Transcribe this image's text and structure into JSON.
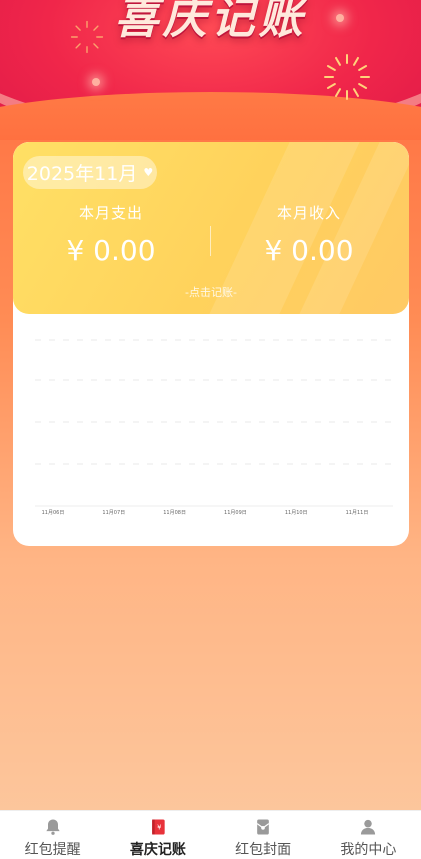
{
  "header": {
    "title": "喜庆记账"
  },
  "summary": {
    "month_selector": "2025年11月",
    "expense_label": "本月支出",
    "expense_value": "¥  0.00",
    "income_label": "本月收入",
    "income_value": "¥  0.00",
    "record_link": "-点击记账-"
  },
  "chart_data": {
    "type": "line",
    "categories": [
      "11月06日",
      "11月07日",
      "11月08日",
      "11月09日",
      "11月10日",
      "11月11日"
    ],
    "series": [
      {
        "values": [
          0,
          0,
          0,
          0,
          0,
          0
        ]
      }
    ],
    "title": "",
    "xlabel": "",
    "ylabel": "",
    "grid": true
  },
  "tabbar": {
    "items": [
      {
        "label": "红包提醒",
        "icon": "bell-icon",
        "active": false
      },
      {
        "label": "喜庆记账",
        "icon": "ledger-book-icon",
        "active": true
      },
      {
        "label": "红包封面",
        "icon": "red-envelope-icon",
        "active": false
      },
      {
        "label": "我的中心",
        "icon": "user-icon",
        "active": false
      }
    ]
  },
  "colors": {
    "accent": "#ff6a3d",
    "card_gold": "#ffd25c",
    "hero_red": "#f0264a",
    "active_tab_icon": "#e8323a"
  }
}
